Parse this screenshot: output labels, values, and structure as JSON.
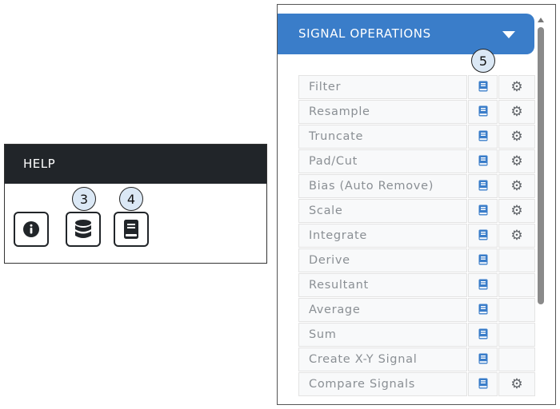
{
  "help": {
    "title": "HELP",
    "buttons": [
      {
        "name": "info-icon"
      },
      {
        "name": "database-icon"
      },
      {
        "name": "book-icon"
      }
    ]
  },
  "callouts": {
    "c3": "3",
    "c4": "4",
    "c5": "5"
  },
  "signal_ops": {
    "title": "SIGNAL OPERATIONS",
    "rows": [
      {
        "label": "Filter",
        "has_settings": true
      },
      {
        "label": "Resample",
        "has_settings": true
      },
      {
        "label": "Truncate",
        "has_settings": true
      },
      {
        "label": "Pad/Cut",
        "has_settings": true
      },
      {
        "label": "Bias (Auto Remove)",
        "has_settings": true
      },
      {
        "label": "Scale",
        "has_settings": true
      },
      {
        "label": "Integrate",
        "has_settings": true
      },
      {
        "label": "Derive",
        "has_settings": false
      },
      {
        "label": "Resultant",
        "has_settings": false
      },
      {
        "label": "Average",
        "has_settings": false
      },
      {
        "label": "Sum",
        "has_settings": false
      },
      {
        "label": "Create X-Y Signal",
        "has_settings": false
      },
      {
        "label": "Compare Signals",
        "has_settings": true
      }
    ]
  },
  "colors": {
    "header_dark": "#212529",
    "accent_blue": "#3a7dc9",
    "doc_icon": "#3a7dc9",
    "gear_icon": "#5f6368"
  }
}
